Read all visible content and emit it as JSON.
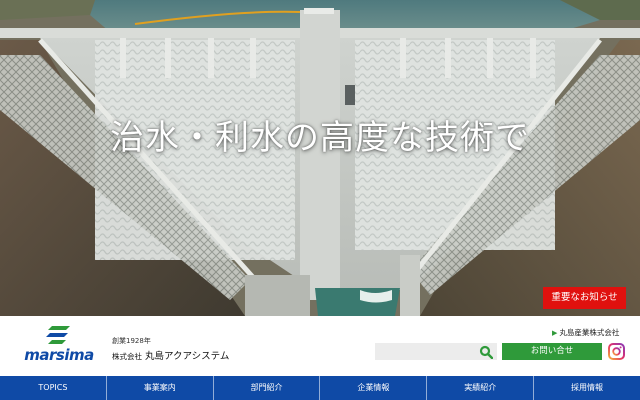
{
  "hero": {
    "headline": "治水・利水の高度な技術で",
    "notice_button": "重要なお知らせ"
  },
  "header": {
    "logo_text": "marsima",
    "founded": "創業1928年",
    "company_type": "株式会社",
    "company_name": "丸島アクアシステム",
    "group_link": "丸島産業株式会社",
    "search_placeholder": "",
    "search_icon": "search-icon",
    "contact_label": "お問い合せ",
    "instagram_icon": "instagram-icon"
  },
  "nav": {
    "items": [
      "TOPICS",
      "事業案内",
      "部門紹介",
      "企業情報",
      "実績紹介",
      "採用情報"
    ]
  },
  "colors": {
    "brand_blue": "#0f4aa6",
    "accent_green": "#2f9a3a",
    "notice_red": "#e0110e"
  }
}
